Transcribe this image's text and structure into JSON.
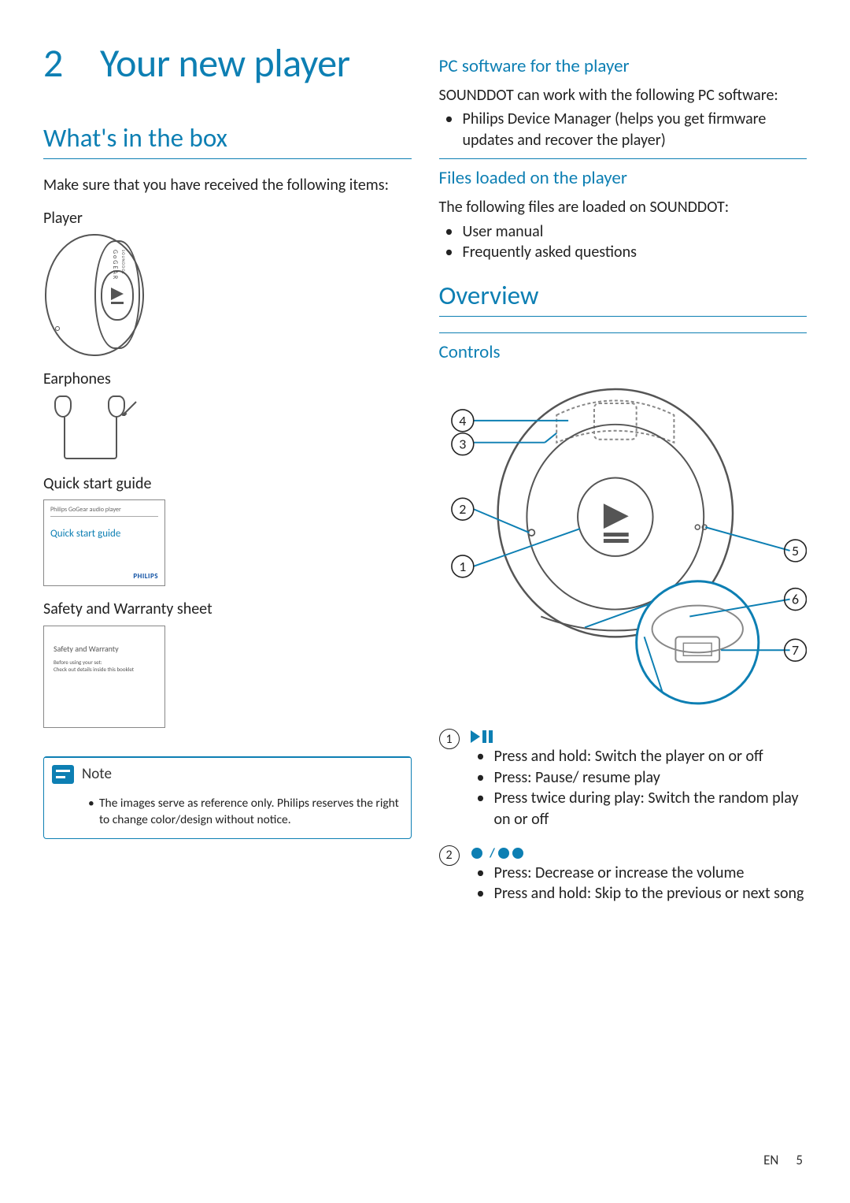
{
  "chapter": {
    "number": "2",
    "title": "Your new player"
  },
  "left": {
    "section1": {
      "title": "What's in the box",
      "intro": "Make sure that you have received the following items:",
      "items": {
        "player": "Player",
        "player_brand": "GoGEAR",
        "player_model": "SOUNDDOT",
        "earphones": "Earphones",
        "qsg": "Quick start guide",
        "qsg_top": "Philips GoGear audio player",
        "qsg_title": "Quick start guide",
        "qsg_brand": "PHILIPS",
        "safety": "Safety and Warranty sheet",
        "safety_t": "Safety and Warranty",
        "safety_s1": "Before using your set:",
        "safety_s2": "Check out details inside this booklet"
      }
    },
    "note": {
      "label": "Note",
      "text": "The images serve as reference only. Philips reserves the right to change color/design without notice."
    }
  },
  "right": {
    "sub1": {
      "title": "PC software for the player",
      "intro_a": "SOUNDDOT",
      "intro_b": " can work with the following PC software:",
      "bullet_bold": "Philips Device Manager",
      "bullet_rest": " (helps you get firmware updates and recover the player)"
    },
    "sub2": {
      "title": "Files loaded on the player",
      "intro_a": "The following files are loaded on ",
      "intro_b": "SOUNDDOT",
      "intro_c": ":",
      "b1": "User manual",
      "b2": "Frequently asked questions"
    },
    "section2": {
      "title": "Overview"
    },
    "sub3": {
      "title": "Controls"
    },
    "diagram_labels": {
      "n1": "1",
      "n2": "2",
      "n3": "3",
      "n4": "4",
      "n5": "5",
      "n6": "6",
      "n7": "7"
    },
    "controls": {
      "c1": {
        "num": "1",
        "b1": "Press and hold: Switch the player on or off",
        "b2": "Press: Pause/ resume play",
        "b3": "Press twice during play: Switch the random play on or off"
      },
      "c2": {
        "num": "2",
        "b1": "Press: Decrease or increase the volume",
        "b2": "Press and hold: Skip to the previous or next song"
      }
    }
  },
  "footer": {
    "lang": "EN",
    "page": "5"
  }
}
